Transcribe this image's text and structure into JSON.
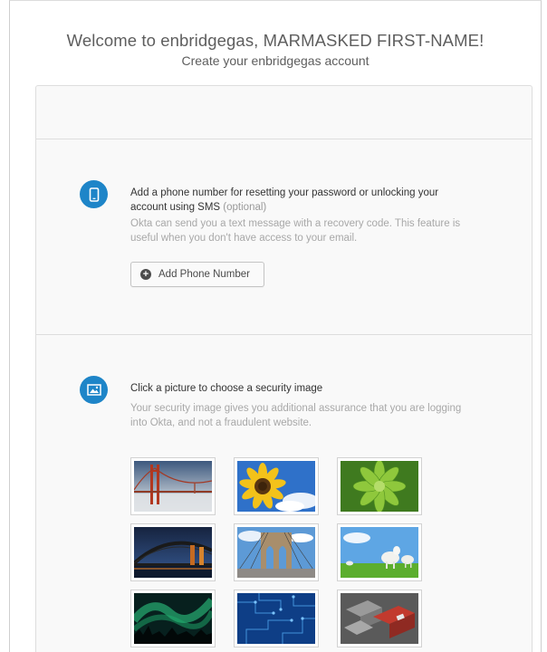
{
  "header": {
    "title": "Welcome to enbridgegas, MARMASKED FIRST-NAME!",
    "subtitle": "Create your enbridgegas account"
  },
  "phone_section": {
    "icon": "mobile-phone-icon",
    "heading_line1": "Add a phone number for resetting your password or unlocking your",
    "heading_line2": "account using SMS",
    "optional_label": "(optional)",
    "desc_line1": "Okta can send you a text message with a recovery code. This feature is",
    "desc_line2": "useful when you don't have access to your email.",
    "button_label": "Add Phone Number",
    "button_icon": "plus-circle-icon"
  },
  "security_image_section": {
    "icon": "picture-icon",
    "heading": "Click a picture to choose a security image",
    "desc_line1": "Your security image gives you additional assurance that you are logging",
    "desc_line2": "into Okta, and not a fraudulent website.",
    "images": [
      {
        "id": "golden-gate-bridge"
      },
      {
        "id": "sunflower"
      },
      {
        "id": "succulent-plant"
      },
      {
        "id": "harbour-bridge-night"
      },
      {
        "id": "brooklyn-bridge"
      },
      {
        "id": "lambs-in-field"
      },
      {
        "id": "aurora-borealis"
      },
      {
        "id": "circuit-board"
      },
      {
        "id": "keyboard-keys"
      }
    ]
  },
  "colors": {
    "accent": "#1e85c8",
    "card_background": "#f9f9f9",
    "muted_text": "#a8a8a8"
  }
}
